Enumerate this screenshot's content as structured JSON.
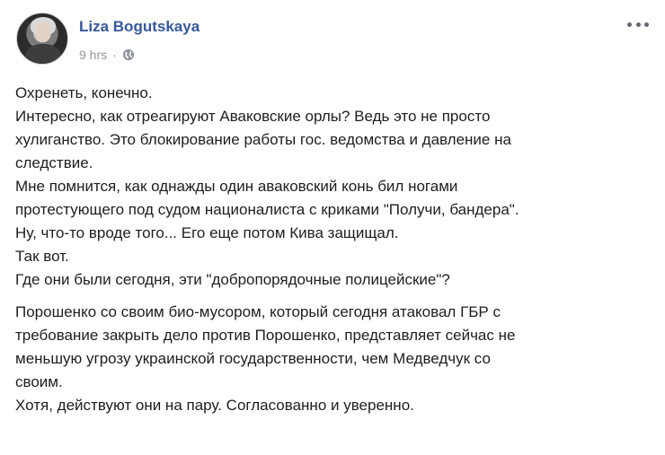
{
  "post": {
    "author": "Liza Bogutskaya",
    "timestamp": "9 hrs",
    "separator": "·",
    "privacy_icon": "globe-icon",
    "more_icon": "more-options-icon",
    "paragraphs": [
      [
        "Охренеть, конечно.",
        "Интересно, как отреагируют Аваковские орлы? Ведь это не просто",
        "хулиганство. Это блокирование работы гос. ведомства и давление на",
        "следствие.",
        "Мне помнится, как однажды один аваковский конь бил ногами",
        "протестующего под судом националиста с криками \"Получи, бандера\".",
        "Ну, что-то вроде того... Его еще потом Кива защищал.",
        "Так вот.",
        "Где они были сегодня, эти \"добропорядочные полицейские\"?"
      ],
      [
        "Порошенко со своим био-мусором, который сегодня атаковал ГБР с",
        "требование закрыть дело против Порошенко, представляет сейчас не",
        "меньшую угрозу украинской государственности, чем Медведчук со",
        "своим.",
        "Хотя, действуют они на пару. Согласованно и уверенно."
      ]
    ]
  },
  "colors": {
    "author": "#365899",
    "meta": "#90949c",
    "text": "#1c1e21"
  }
}
